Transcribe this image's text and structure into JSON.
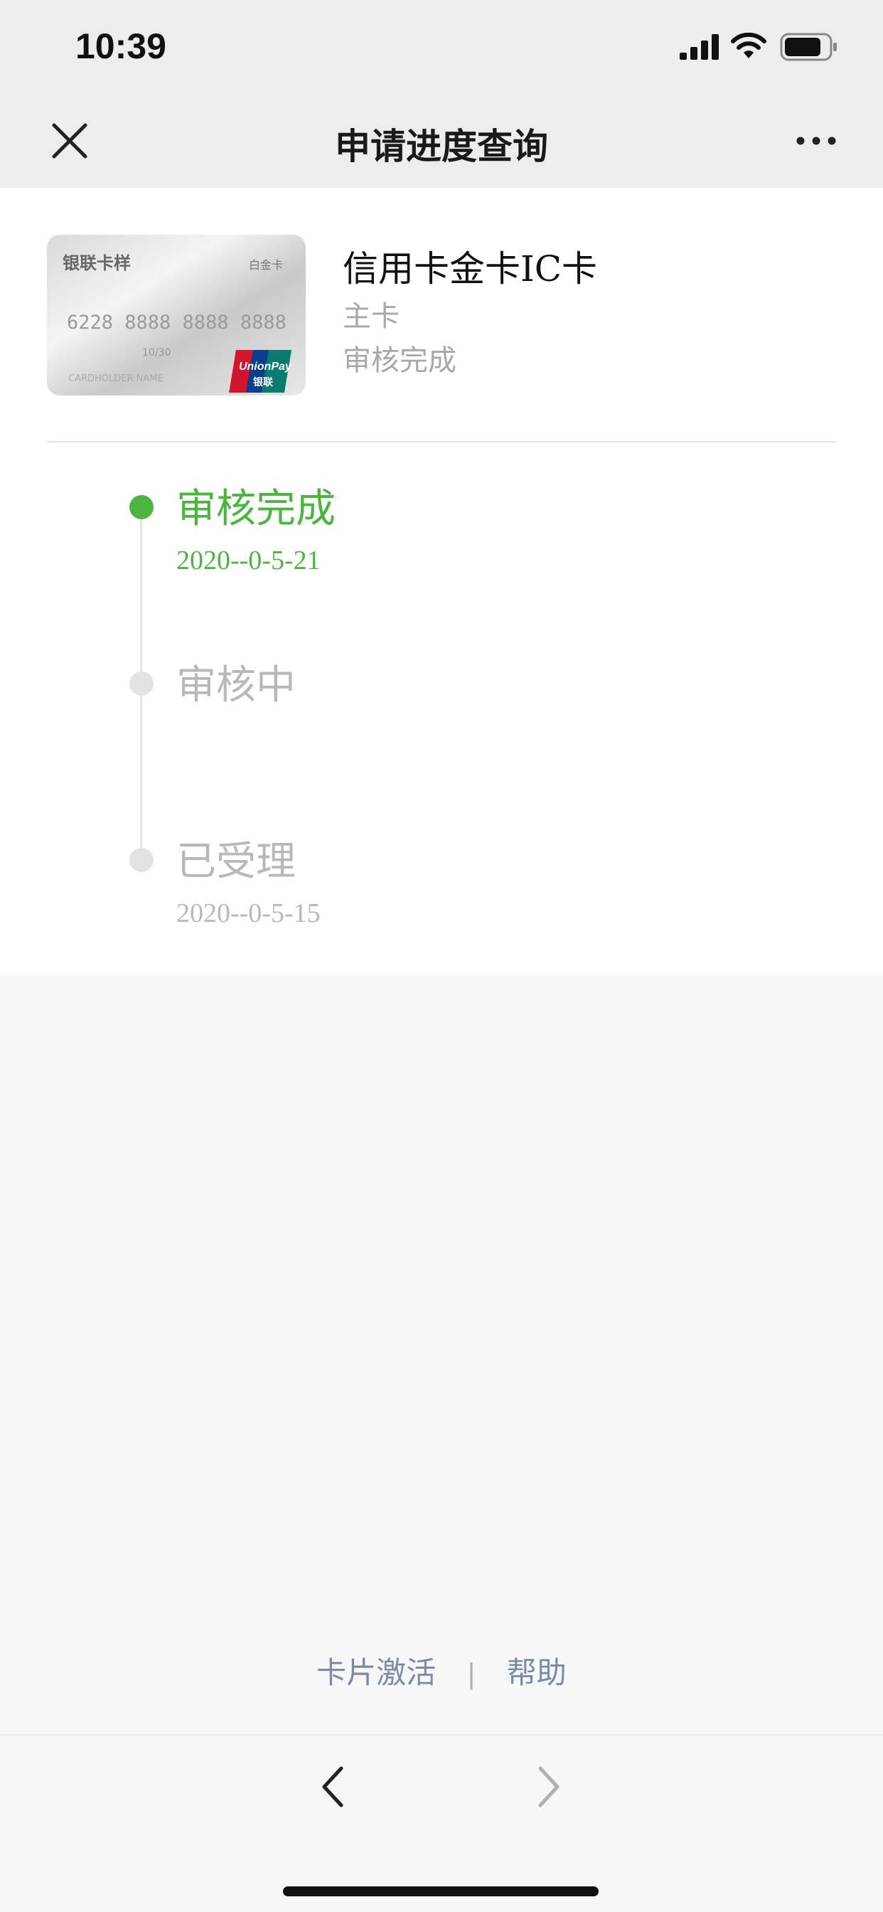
{
  "status_bar": {
    "time": "10:39"
  },
  "nav": {
    "title": "申请进度查询"
  },
  "card": {
    "name": "信用卡金卡IC卡",
    "type": "主卡",
    "status": "审核完成",
    "image": {
      "brand_text": "银联卡样",
      "tier_text": "白金卡",
      "number_text": "6228 8888 8888 8888",
      "valid_text": "10/30",
      "holder_text": "CARDHOLDER NAME",
      "logo_text": "UnionPay",
      "logo_cn_text": "银联"
    }
  },
  "timeline": [
    {
      "title": "审核完成",
      "date": "2020--0-5-21",
      "state": "active"
    },
    {
      "title": "审核中",
      "date": "",
      "state": "inactive"
    },
    {
      "title": "已受理",
      "date": "2020--0-5-15",
      "state": "inactive"
    }
  ],
  "footer": {
    "activate": "卡片激活",
    "separator": "|",
    "help": "帮助"
  },
  "colors": {
    "accent": "#4cb43f",
    "inactive": "#b8b8b8",
    "link": "#7a8aa8"
  },
  "icons": [
    "signal-icon",
    "wifi-icon",
    "battery-icon",
    "close-icon",
    "more-icon",
    "back-icon",
    "forward-icon"
  ]
}
